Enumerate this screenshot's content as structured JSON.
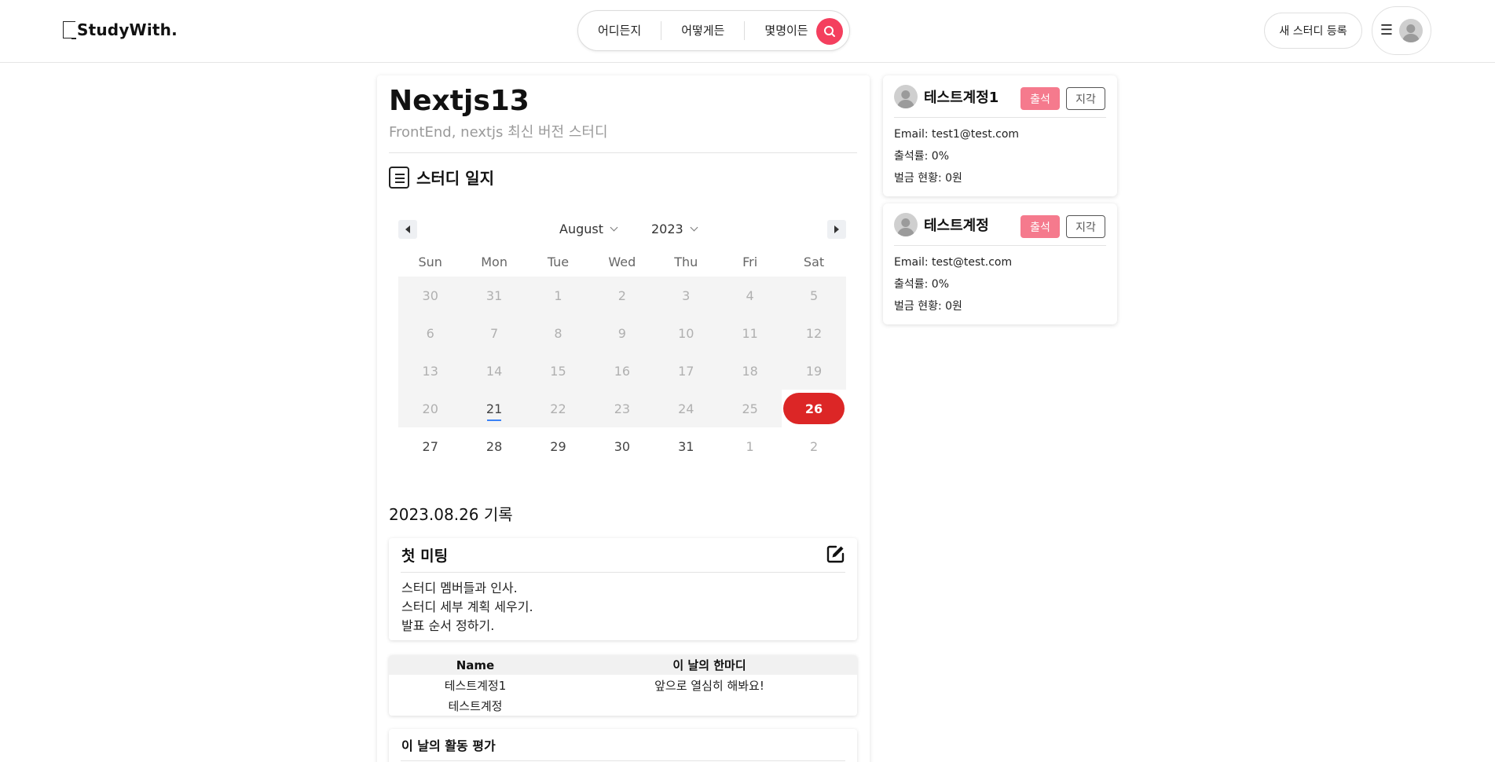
{
  "header": {
    "logo_text": "StudyWith.",
    "search": {
      "where": "어디든지",
      "how": "어떻게든",
      "people": "몇명이든"
    },
    "new_study_label": "새 스터디 등록"
  },
  "study": {
    "title": "Nextjs13",
    "subtitle": "FrontEnd, nextjs 최신 버전 스터디",
    "log_title": "스터디 일지"
  },
  "calendar": {
    "month": "August",
    "year": "2023",
    "weekdays": [
      "Sun",
      "Mon",
      "Tue",
      "Wed",
      "Thu",
      "Fri",
      "Sat"
    ],
    "today": 21,
    "selected": 26,
    "weeks": [
      [
        "30",
        "31",
        "1",
        "2",
        "3",
        "4",
        "5"
      ],
      [
        "6",
        "7",
        "8",
        "9",
        "10",
        "11",
        "12"
      ],
      [
        "13",
        "14",
        "15",
        "16",
        "17",
        "18",
        "19"
      ],
      [
        "20",
        "21",
        "22",
        "23",
        "24",
        "25",
        "26"
      ],
      [
        "27",
        "28",
        "29",
        "30",
        "31",
        "1",
        "2"
      ]
    ]
  },
  "record": {
    "date_label": "2023.08.26 기록",
    "meeting": {
      "title": "첫 미팅",
      "lines": [
        "스터디 멤버들과 인사.",
        "스터디 세부 계획 세우기.",
        "발표 순서 정하기."
      ]
    },
    "table": {
      "headers": [
        "Name",
        "이 날의 한마디"
      ],
      "rows": [
        [
          "테스트계정1",
          "앞으로 열심히 해봐요!"
        ],
        [
          "테스트계정",
          ""
        ]
      ]
    },
    "evaluation_title": "이 날의 활동 평가"
  },
  "members": [
    {
      "name": "테스트계정1",
      "attend_label": "출석",
      "late_label": "지각",
      "email": "Email: test1@test.com",
      "attendance": "출석률: 0%",
      "fine": "벌금 현황: 0원"
    },
    {
      "name": "테스트계정",
      "attend_label": "출석",
      "late_label": "지각",
      "email": "Email: test@test.com",
      "attendance": "출석률: 0%",
      "fine": "벌금 현황: 0원"
    }
  ],
  "colors": {
    "accent": "#f43f5e",
    "selected_day": "#dc2626",
    "attend": "#f57a8d",
    "today_marker": "#3b82f6"
  }
}
